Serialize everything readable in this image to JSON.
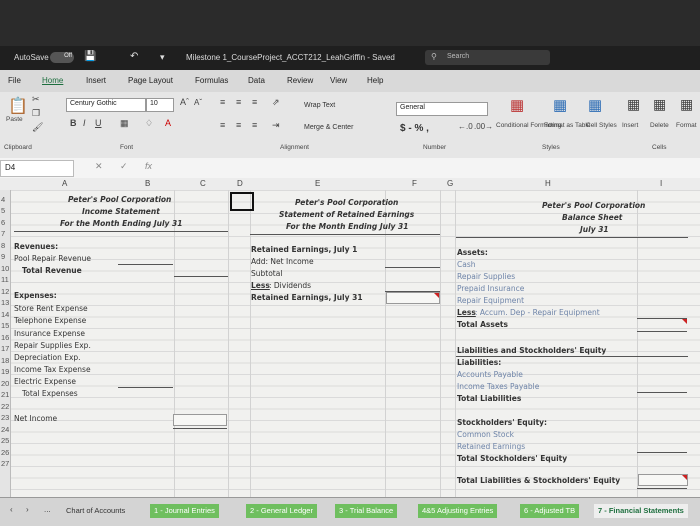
{
  "titlebar": {
    "autosave_label": "AutoSave",
    "autosave_state": "Off",
    "title": "Milestone 1_CourseProject_ACCT212_LeahGriffin - Saved",
    "search_placeholder": "Search"
  },
  "menu": [
    "File",
    "Home",
    "Insert",
    "Page Layout",
    "Formulas",
    "Data",
    "Review",
    "View",
    "Help"
  ],
  "ribbon": {
    "paste": "Paste",
    "font_name": "Century Gothic",
    "font_size": "10",
    "wrap_text": "Wrap Text",
    "merge_center": "Merge & Center",
    "number_format": "General",
    "currency": "$ - % ,",
    "conditional": "Conditional Formatting",
    "format_table": "Format as Table",
    "cell_styles": "Cell Styles",
    "insert": "Insert",
    "delete": "Delete",
    "format": "Format",
    "groups": {
      "clipboard": "Clipboard",
      "font": "Font",
      "alignment": "Alignment",
      "number": "Number",
      "styles": "Styles",
      "cells": "Cells"
    }
  },
  "formula_bar": {
    "name_box": "D4",
    "fx": "fx",
    "content": ""
  },
  "columns": [
    "A",
    "B",
    "C",
    "D",
    "E",
    "F",
    "G",
    "H",
    "I"
  ],
  "rows": [
    "4",
    "5",
    "6",
    "7",
    "8",
    "9",
    "10",
    "11",
    "12",
    "13",
    "14",
    "15",
    "16",
    "17",
    "18",
    "19",
    "20",
    "21",
    "22",
    "23",
    "24",
    "25",
    "26",
    "27"
  ],
  "income_statement": {
    "company": "Peter's Pool Corporation",
    "title": "Income Statement",
    "period": "For the Month Ending July 31",
    "revenues_header": "Revenues:",
    "pool_repair": "Pool Repair Revenue",
    "total_revenue": "Total Revenue",
    "expenses_header": "Expenses:",
    "expenses": [
      "Store Rent Expense",
      "Telephone Expense",
      "Insurance Expense",
      "Repair Supplies Exp.",
      "Depreciation Exp.",
      "Income Tax Expense",
      "Electric Expense"
    ],
    "total_expenses": "Total Expenses",
    "net_income": "Net Income"
  },
  "retained_earnings": {
    "company": "Peter's Pool Corporation",
    "title": "Statement of Retained Earnings",
    "period": "For the Month Ending July 31",
    "re_july1": "Retained Earnings, July 1",
    "add_net_income": "Add: Net Income",
    "subtotal": "Subtotal",
    "less_prefix": "Less",
    "dividends": ": Dividends",
    "re_july31": "Retained Earnings, July 31"
  },
  "balance_sheet": {
    "company": "Peter's Pool Corporation",
    "title": "Balance Sheet",
    "date": "July 31",
    "assets_header": "Assets:",
    "assets": [
      "Cash",
      "Repair Supplies",
      "Prepaid Insurance",
      "Repair Equipment"
    ],
    "less_prefix": "Less",
    "accum_dep": ": Accum. Dep - Repair Equipment",
    "total_assets": "Total Assets",
    "liab_equity_header": "Liabilities and Stockholders' Equity",
    "liabilities_header": "Liabilities:",
    "liabilities": [
      "Accounts Payable",
      "Income Taxes Payable"
    ],
    "total_liabilities": "Total Liabilities",
    "equity_header": "Stockholders' Equity:",
    "equity": [
      "Common Stock",
      "Retained Earnings"
    ],
    "total_equity": "Total Stockholders' Equity",
    "total_le": "Total Liabilities & Stockholders' Equity"
  },
  "tabs": [
    "Chart of Accounts",
    "1 - Journal Entries",
    "2 - General Ledger",
    "3 - Trial Balance",
    "4&5 Adjusting Entries",
    "6 - Adjusted TB",
    "7 - Financial Statements"
  ],
  "tab_nav": [
    "‹",
    "›",
    "..."
  ],
  "colors": {
    "tab_green": "#6fbf5f",
    "excel_green": "#1e6f3f",
    "error_red": "#cc2222"
  }
}
